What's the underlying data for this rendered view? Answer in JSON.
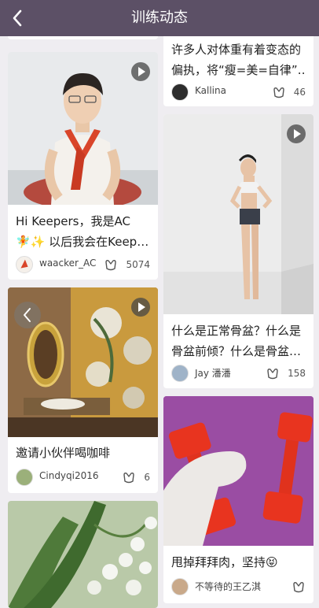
{
  "header": {
    "title": "训练动态",
    "back": "back-icon"
  },
  "cards": [
    {
      "lines": [
        "Hi Keepers，我是AC",
        "🧚✨ 以后我会在Keep…"
      ],
      "user": "waacker_AC",
      "likes": "5074"
    },
    {
      "lines": [
        "邀请小伙伴喝咖啡"
      ],
      "user": "Cindyqi2016",
      "likes": "6"
    },
    {
      "lines": [],
      "user": "",
      "likes": ""
    },
    {
      "lines": [
        "许多人对体重有着变态的",
        "偏执，将“瘦=美=自律”…"
      ],
      "user": "Kallina",
      "likes": "46"
    },
    {
      "lines": [
        "什么是正常骨盆？什么是",
        "骨盆前倾？什么是骨盆…"
      ],
      "user": "Jay 潘潘",
      "likes": "158"
    },
    {
      "lines": [
        "甩掉拜拜肉，坚持😝"
      ],
      "user": "不等待的王乙淇",
      "likes": ""
    }
  ],
  "colors": {
    "header": "#5c5066",
    "background": "#efedf1"
  }
}
